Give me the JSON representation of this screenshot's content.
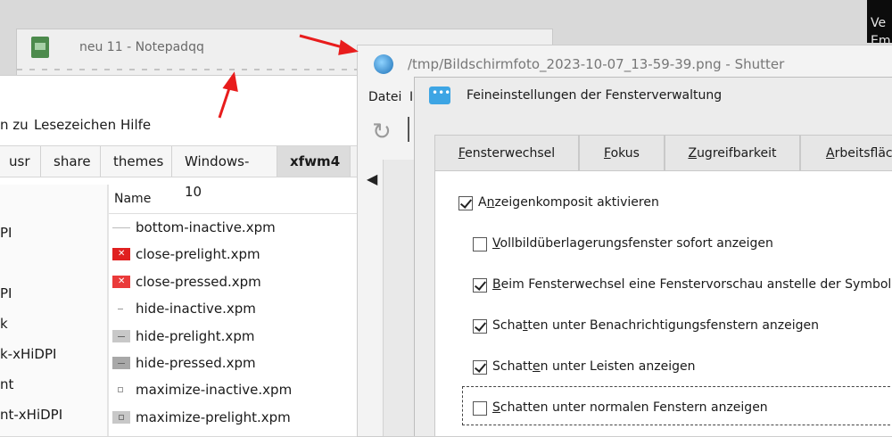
{
  "terminal": {
    "line1": "Ve",
    "line2": "Em"
  },
  "notepad": {
    "title": "neu 11 - Notepadqq"
  },
  "filemanager": {
    "menu": [
      "n zu",
      "Lesezeichen",
      "Hilfe"
    ],
    "breadcrumbs": [
      "usr",
      "share",
      "themes",
      "Windows-10",
      "xfwm4"
    ],
    "active_crumb": "xfwm4",
    "sidebar": [
      "PI",
      "",
      "PI",
      "k",
      "k-xHiDPI",
      "nt",
      "nt-xHiDPI"
    ],
    "column_header": "Name",
    "files": [
      {
        "name": "bottom-inactive.xpm",
        "icon": "bottom-icon",
        "color": "#bbbbbb"
      },
      {
        "name": "close-prelight.xpm",
        "icon": "close-red-icon",
        "color": "#e02020"
      },
      {
        "name": "close-pressed.xpm",
        "icon": "close-red-icon",
        "color": "#ea3a3a"
      },
      {
        "name": "hide-inactive.xpm",
        "icon": "dash-icon",
        "color": "#9a9a9a"
      },
      {
        "name": "hide-prelight.xpm",
        "icon": "hide-gray-icon",
        "color": "#c8c8c8"
      },
      {
        "name": "hide-pressed.xpm",
        "icon": "hide-gray-icon",
        "color": "#a8a8a8"
      },
      {
        "name": "maximize-inactive.xpm",
        "icon": "square-icon",
        "color": "#9a9a9a"
      },
      {
        "name": "maximize-prelight.xpm",
        "icon": "square-gray-icon",
        "color": "#c8c8c8"
      }
    ]
  },
  "shutter": {
    "title": "/tmp/Bildschirmfoto_2023-10-07_13-59-39.png - Shutter",
    "menu_datei": "Datei",
    "menu_next": "I"
  },
  "dialog": {
    "title": "Feineinstellungen der Fensterverwaltung",
    "tabs": [
      {
        "pre": "",
        "u": "F",
        "post": "ensterwechsel"
      },
      {
        "pre": "",
        "u": "F",
        "post": "okus"
      },
      {
        "pre": "",
        "u": "Z",
        "post": "ugreifbarkeit"
      },
      {
        "pre": "",
        "u": "A",
        "post": "rbeitsfläc"
      }
    ],
    "options": [
      {
        "pre": "A",
        "u": "n",
        "post": "zeigenkomposit aktivieren",
        "checked": true
      },
      {
        "pre": "",
        "u": "V",
        "post": "ollbildüberlagerungsfenster sofort anzeigen",
        "checked": false
      },
      {
        "pre": "",
        "u": "B",
        "post": "eim Fensterwechsel eine Fenstervorschau anstelle der Symbole a",
        "checked": true
      },
      {
        "pre": "Scha",
        "u": "t",
        "post": "ten unter Benachrichtigungsfenstern anzeigen",
        "checked": true
      },
      {
        "pre": "Schatt",
        "u": "e",
        "post": "n unter Leisten anzeigen",
        "checked": true
      },
      {
        "pre": "",
        "u": "S",
        "post": "chatten unter normalen Fenstern anzeigen",
        "checked": false
      }
    ]
  }
}
